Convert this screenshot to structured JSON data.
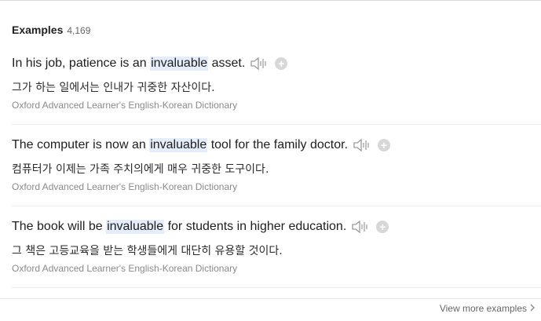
{
  "header": {
    "title": "Examples",
    "count": "4,169"
  },
  "examples": [
    {
      "pre": "In his job, patience is an ",
      "keyword": "invaluable",
      "post": " asset.",
      "translation": "그가 하는 일에서는 인내가 귀중한 자산이다.",
      "source": "Oxford Advanced Learner's English-Korean Dictionary"
    },
    {
      "pre": "The computer is now an ",
      "keyword": "invaluable",
      "post": " tool for the family doctor.",
      "translation": "컴퓨터가 이제는 가족 주치의에게 매우 귀중한 도구이다.",
      "source": "Oxford Advanced Learner's English-Korean Dictionary"
    },
    {
      "pre": "The book will be ",
      "keyword": "invaluable",
      "post": " for students in higher education.",
      "translation": "그 책은 고등교육을 받는 학생들에게 대단히 유용할 것이다.",
      "source": "Oxford Advanced Learner's English-Korean Dictionary"
    }
  ],
  "footer": {
    "view_more": "View more examples"
  },
  "icons": {
    "speaker": "speaker-icon",
    "add": "plus-icon",
    "chevron": "chevron-right-icon"
  },
  "colors": {
    "highlight": "#e4edf9",
    "add_button": "#d7d7d7"
  }
}
